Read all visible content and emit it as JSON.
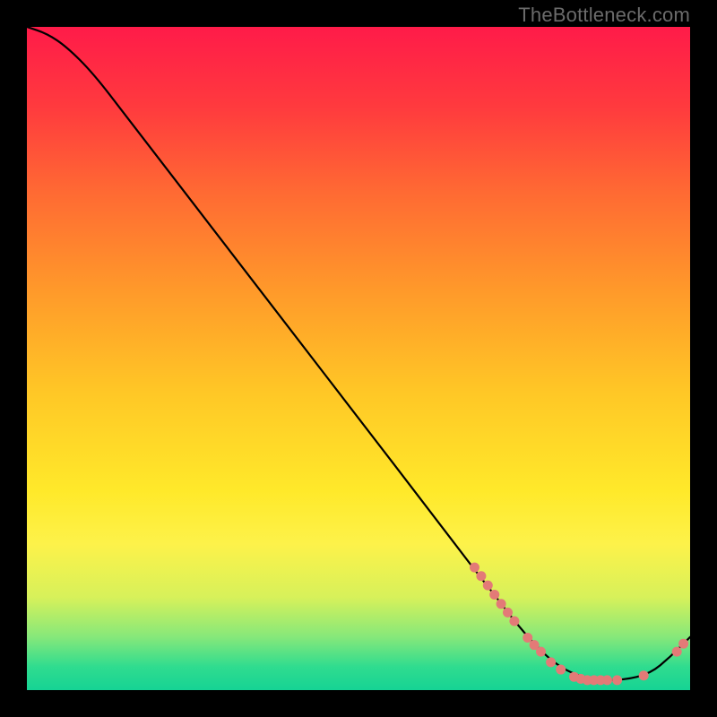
{
  "attribution": "TheBottleneck.com",
  "chart_data": {
    "type": "line",
    "title": "",
    "xlabel": "",
    "ylabel": "",
    "xlim": [
      0,
      100
    ],
    "ylim": [
      0,
      100
    ],
    "background_gradient_stops": [
      {
        "offset": 0,
        "color": "#ff1b49"
      },
      {
        "offset": 0.12,
        "color": "#ff3a3e"
      },
      {
        "offset": 0.25,
        "color": "#ff6a33"
      },
      {
        "offset": 0.4,
        "color": "#ff9a2a"
      },
      {
        "offset": 0.55,
        "color": "#ffc726"
      },
      {
        "offset": 0.7,
        "color": "#ffe92a"
      },
      {
        "offset": 0.78,
        "color": "#fdf24a"
      },
      {
        "offset": 0.86,
        "color": "#d7f15a"
      },
      {
        "offset": 0.92,
        "color": "#86e87a"
      },
      {
        "offset": 0.965,
        "color": "#2fdc8f"
      },
      {
        "offset": 1.0,
        "color": "#16d394"
      }
    ],
    "series": [
      {
        "name": "bottleneck-curve",
        "color": "#000000",
        "points": [
          {
            "x": 0,
            "y": 100
          },
          {
            "x": 3,
            "y": 99
          },
          {
            "x": 6,
            "y": 97
          },
          {
            "x": 10,
            "y": 93
          },
          {
            "x": 15,
            "y": 86.5
          },
          {
            "x": 20,
            "y": 80
          },
          {
            "x": 30,
            "y": 67
          },
          {
            "x": 40,
            "y": 54
          },
          {
            "x": 50,
            "y": 41
          },
          {
            "x": 60,
            "y": 28
          },
          {
            "x": 68,
            "y": 17.5
          },
          {
            "x": 70,
            "y": 15
          },
          {
            "x": 75,
            "y": 8.5
          },
          {
            "x": 80,
            "y": 3.5
          },
          {
            "x": 85,
            "y": 1.5
          },
          {
            "x": 90,
            "y": 1.5
          },
          {
            "x": 94,
            "y": 2.5
          },
          {
            "x": 97,
            "y": 5
          },
          {
            "x": 100,
            "y": 8
          }
        ]
      }
    ],
    "markers": {
      "name": "highlighted-points",
      "color": "#e37a77",
      "radius": 5.5,
      "points": [
        {
          "x": 67.5,
          "y": 18.5
        },
        {
          "x": 68.5,
          "y": 17.2
        },
        {
          "x": 69.5,
          "y": 15.8
        },
        {
          "x": 70.5,
          "y": 14.4
        },
        {
          "x": 71.5,
          "y": 13.0
        },
        {
          "x": 72.5,
          "y": 11.7
        },
        {
          "x": 73.5,
          "y": 10.4
        },
        {
          "x": 75.5,
          "y": 7.9
        },
        {
          "x": 76.5,
          "y": 6.8
        },
        {
          "x": 77.5,
          "y": 5.8
        },
        {
          "x": 79.0,
          "y": 4.2
        },
        {
          "x": 80.5,
          "y": 3.1
        },
        {
          "x": 82.5,
          "y": 2.0
        },
        {
          "x": 83.5,
          "y": 1.7
        },
        {
          "x": 84.5,
          "y": 1.5
        },
        {
          "x": 85.5,
          "y": 1.5
        },
        {
          "x": 86.5,
          "y": 1.5
        },
        {
          "x": 87.5,
          "y": 1.5
        },
        {
          "x": 89.0,
          "y": 1.5
        },
        {
          "x": 93.0,
          "y": 2.2
        },
        {
          "x": 98.0,
          "y": 5.8
        },
        {
          "x": 99.0,
          "y": 7.0
        }
      ]
    }
  }
}
